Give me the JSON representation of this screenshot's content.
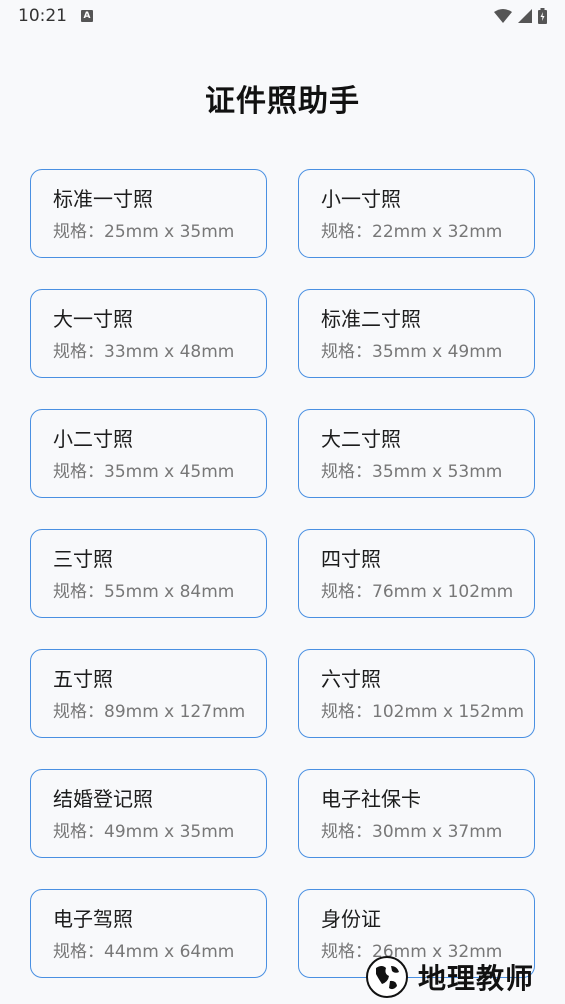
{
  "status": {
    "time": "10:21",
    "notification_icon": "a-icon"
  },
  "title": "证件照助手",
  "spec_prefix": "规格：",
  "cards": [
    {
      "name": "标准一寸照",
      "spec": "规格：25mm x 35mm"
    },
    {
      "name": "小一寸照",
      "spec": "规格：22mm x 32mm"
    },
    {
      "name": "大一寸照",
      "spec": "规格：33mm x 48mm"
    },
    {
      "name": "标准二寸照",
      "spec": "规格：35mm x 49mm"
    },
    {
      "name": "小二寸照",
      "spec": "规格：35mm x 45mm"
    },
    {
      "name": "大二寸照",
      "spec": "规格：35mm x 53mm"
    },
    {
      "name": "三寸照",
      "spec": "规格：55mm x 84mm"
    },
    {
      "name": "四寸照",
      "spec": "规格：76mm x 102mm"
    },
    {
      "name": "五寸照",
      "spec": "规格：89mm x 127mm"
    },
    {
      "name": "六寸照",
      "spec": "规格：102mm x 152mm"
    },
    {
      "name": "结婚登记照",
      "spec": "规格：49mm x 35mm"
    },
    {
      "name": "电子社保卡",
      "spec": "规格：30mm x 37mm"
    },
    {
      "name": "电子驾照",
      "spec": "规格：44mm x 64mm"
    },
    {
      "name": "身份证",
      "spec": "规格：26mm x 32mm"
    }
  ],
  "watermark": {
    "text": "地理教师"
  },
  "colors": {
    "accent": "#4a90e2",
    "background": "#f8f9fb"
  }
}
